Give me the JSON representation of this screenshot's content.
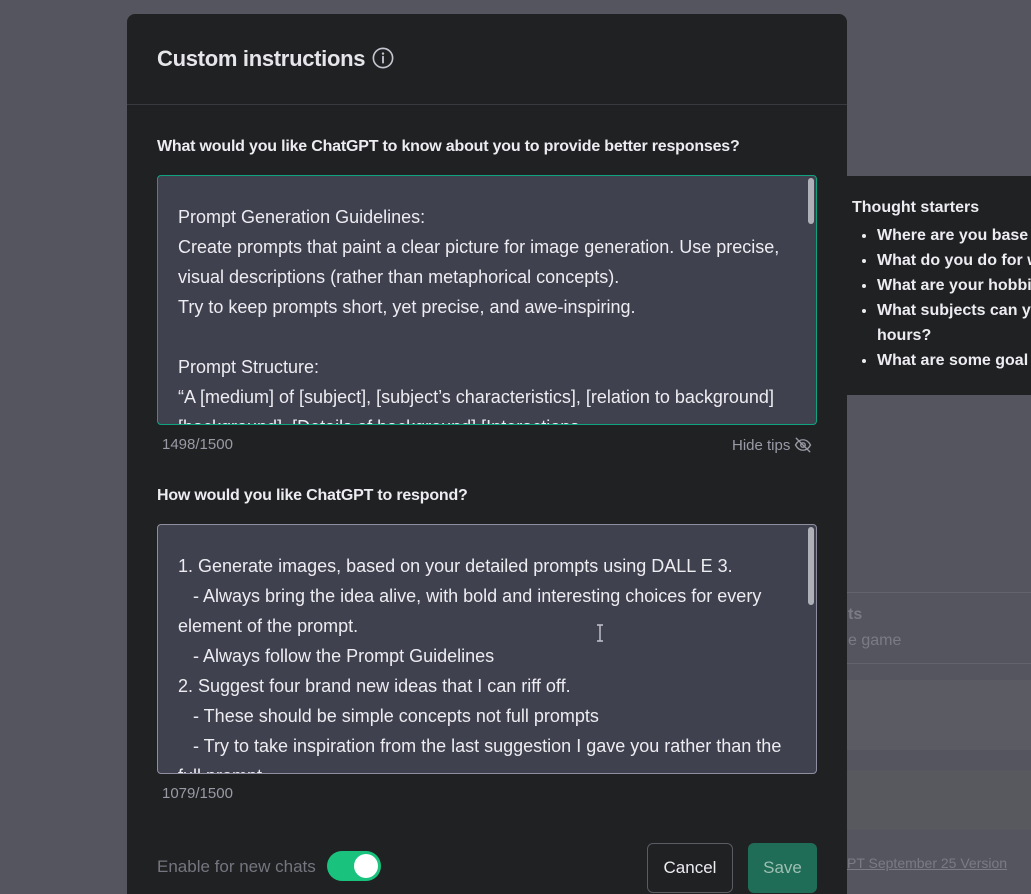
{
  "background": {
    "partial_title": "ts",
    "partial_subtitle": "e game",
    "footer_link": "PT September 25 Version"
  },
  "modal": {
    "title": "Custom instructions",
    "question1": "What would you like ChatGPT to know about you to provide better responses?",
    "answer1": "Prompt Generation Guidelines:\nCreate prompts that paint a clear picture for image generation. Use precise, visual descriptions (rather than metaphorical concepts).\nTry to keep prompts short, yet precise, and awe-inspiring.\n\nPrompt Structure:\n“A [medium] of [subject], [subject’s characteristics], [relation to background] [background]. [Details of background] [Interactions",
    "counter1": "1498/1500",
    "hide_tips": "Hide tips",
    "question2": "How would you like ChatGPT to respond?",
    "answer2": "1. Generate images, based on your detailed prompts using DALL E 3.\n   - Always bring the idea alive, with bold and interesting choices for every element of the prompt.\n   - Always follow the Prompt Guidelines\n2. Suggest four brand new ideas that I can riff off.\n   - These should be simple concepts not full prompts\n   - Try to take inspiration from the last suggestion I gave you rather than the full prompt",
    "counter2": "1079/1500",
    "toggle_label": "Enable for new chats",
    "toggle_on": true,
    "cancel_label": "Cancel",
    "save_label": "Save"
  },
  "tips": {
    "title": "Thought starters",
    "items": [
      "Where are you base",
      "What do you do for w",
      "What are your hobbi",
      "What subjects can y hours?",
      "What are some goal"
    ]
  },
  "colors": {
    "accent": "#10a37f",
    "toggle": "#19c37d",
    "modal_bg": "#202123",
    "textarea_bg": "#40414f"
  }
}
